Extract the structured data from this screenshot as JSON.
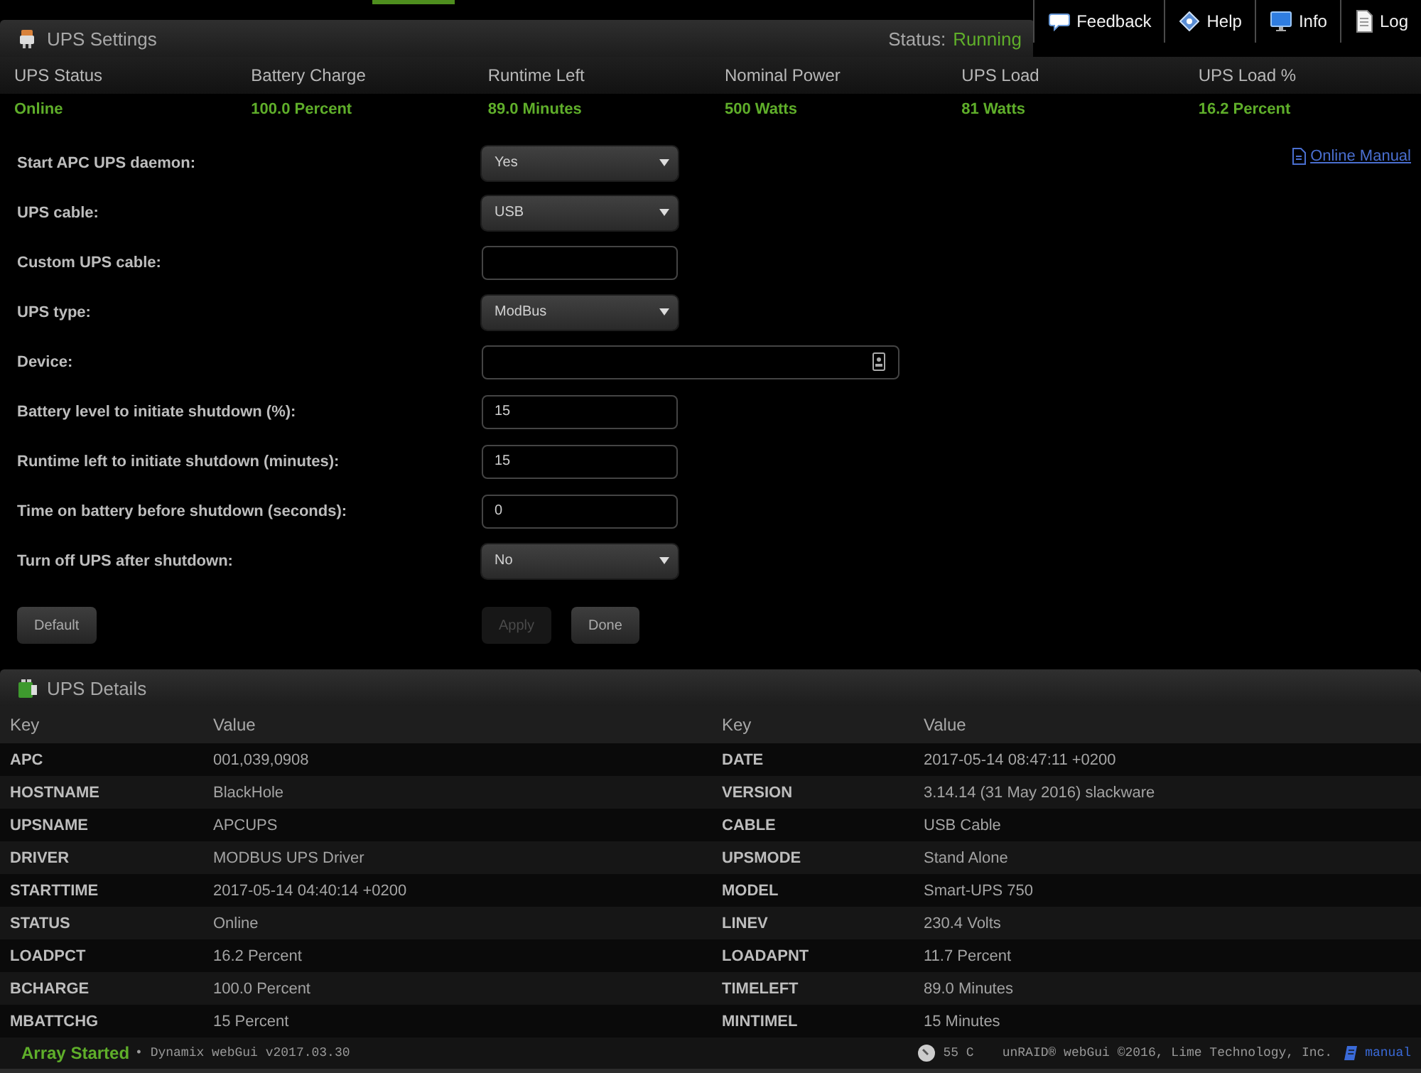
{
  "top_bar": {
    "active_menu_underline": true
  },
  "nav": [
    {
      "kind": "feedback",
      "label": "Feedback"
    },
    {
      "kind": "help",
      "label": "Help"
    },
    {
      "kind": "info",
      "label": "Info"
    },
    {
      "kind": "log",
      "label": "Log"
    }
  ],
  "settings_panel": {
    "title": "UPS Settings",
    "status_label": "Status:",
    "status_value": "Running"
  },
  "summary": [
    {
      "heading": "UPS Status",
      "value": "Online"
    },
    {
      "heading": "Battery Charge",
      "value": "100.0 Percent"
    },
    {
      "heading": "Runtime Left",
      "value": "89.0 Minutes"
    },
    {
      "heading": "Nominal Power",
      "value": "500 Watts"
    },
    {
      "heading": "UPS Load",
      "value": "81 Watts"
    },
    {
      "heading": "UPS Load %",
      "value": "16.2 Percent"
    }
  ],
  "form": {
    "manual_link": "Online Manual",
    "fields": [
      {
        "label": "Start APC UPS daemon:",
        "kind": "select",
        "value": "Yes"
      },
      {
        "label": "UPS cable:",
        "kind": "select",
        "value": "USB"
      },
      {
        "label": "Custom UPS cable:",
        "kind": "text"
      },
      {
        "label": "UPS type:",
        "kind": "select",
        "value": "ModBus"
      },
      {
        "label": "Device:",
        "kind": "path"
      },
      {
        "label": "Battery level to initiate shutdown (%):",
        "kind": "text",
        "value": "15"
      },
      {
        "label": "Runtime left to initiate shutdown (minutes):",
        "kind": "text",
        "value": "15"
      },
      {
        "label": "Time on battery before shutdown (seconds):",
        "kind": "text",
        "value": "0"
      },
      {
        "label": "Turn off UPS after shutdown:",
        "kind": "select",
        "value": "No"
      }
    ],
    "reset_button": {
      "label": "Default",
      "disabled": false
    },
    "action_buttons": [
      {
        "label": "Apply",
        "disabled": true
      },
      {
        "label": "Done",
        "disabled": false
      }
    ]
  },
  "details_panel": {
    "title": "UPS Details",
    "tables": [
      {
        "columns": [
          "Key",
          "Value"
        ],
        "rows": [
          [
            "APC",
            "001,039,0908"
          ],
          [
            "HOSTNAME",
            "BlackHole"
          ],
          [
            "UPSNAME",
            "APCUPS"
          ],
          [
            "DRIVER",
            "MODBUS UPS Driver"
          ],
          [
            "STARTTIME",
            "2017-05-14 04:40:14 +0200"
          ],
          [
            "STATUS",
            "Online"
          ],
          [
            "LOADPCT",
            "16.2 Percent"
          ],
          [
            "BCHARGE",
            "100.0 Percent"
          ],
          [
            "MBATTCHG",
            "15 Percent"
          ]
        ]
      },
      {
        "columns": [
          "Key",
          "Value"
        ],
        "rows": [
          [
            "DATE",
            "2017-05-14 08:47:11 +0200"
          ],
          [
            "VERSION",
            "3.14.14 (31 May 2016) slackware"
          ],
          [
            "CABLE",
            "USB Cable"
          ],
          [
            "UPSMODE",
            "Stand Alone"
          ],
          [
            "MODEL",
            "Smart-UPS 750"
          ],
          [
            "LINEV",
            "230.4 Volts"
          ],
          [
            "LOADAPNT",
            "11.7 Percent"
          ],
          [
            "TIMELEFT",
            "89.0 Minutes"
          ],
          [
            "MINTIMEL",
            "15 Minutes"
          ]
        ]
      }
    ]
  },
  "footer": {
    "array_status": "Array Started",
    "version": "• Dynamix webGui v2017.03.30",
    "temperature": "55 C",
    "copyright": "unRAID® webGui ©2016, Lime Technology, Inc.",
    "manual_link": "manual"
  }
}
